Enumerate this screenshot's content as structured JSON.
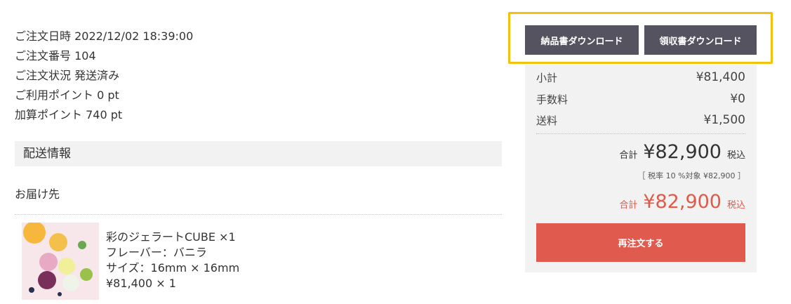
{
  "order": {
    "date_line": "ご注文日時 2022/12/02 18:39:00",
    "number_line": "ご注文番号 104",
    "status_line": "ご注文状況 発送済み",
    "points_used_line": "ご利用ポイント 0 pt",
    "points_added_line": "加算ポイント 740 pt"
  },
  "shipping": {
    "section_title": "配送情報",
    "destination_label": "お届け先"
  },
  "product": {
    "name_qty": "彩のジェラートCUBE ×1",
    "flavor": "フレーバー：バニラ",
    "size": "サイズ：16mm × 16mm",
    "price_qty": "¥81,400 × 1"
  },
  "buttons": {
    "invoice_download": "納品書ダウンロード",
    "receipt_download": "領収書ダウンロード",
    "reorder": "再注文する"
  },
  "summary": {
    "subtotal_label": "小計",
    "subtotal_value": "¥81,400",
    "fee_label": "手数料",
    "fee_value": "¥0",
    "shipping_label": "送料",
    "shipping_value": "¥1,500",
    "total_label": "合計",
    "total_value": "¥82,900",
    "tax_included": "税込",
    "tax_note": "［ 税率 10 %対象 ¥82,900 ］",
    "grand_total_label": "合計",
    "grand_total_value": "¥82,900",
    "grand_tax_included": "税込"
  },
  "colors": {
    "accent_red": "#e05a4e",
    "button_dark": "#555360",
    "highlight_yellow": "#f4c20d",
    "panel_gray": "#f2f2f2"
  }
}
